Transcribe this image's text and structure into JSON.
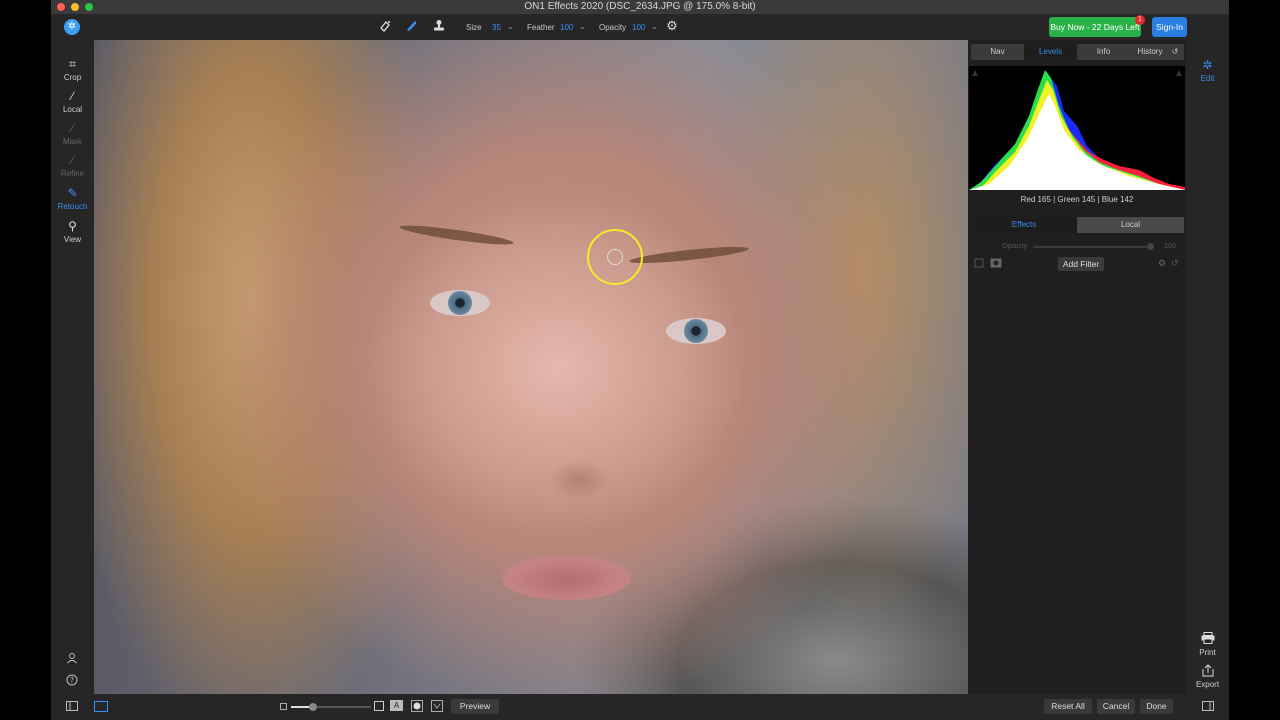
{
  "window": {
    "title": "ON1 Effects 2020 (DSC_2634.JPG @ 175.0% 8-bit)"
  },
  "toolbar": {
    "logo_glyph": "✲",
    "size_label": "Size",
    "size_value": "35",
    "feather_label": "Feather",
    "feather_value": "100",
    "opacity_label": "Opacity",
    "opacity_value": "100",
    "buy_label": "Buy Now - 22 Days Left",
    "buy_badge": "1",
    "signin_label": "Sign-In",
    "caret": "⌄"
  },
  "left_tools": [
    {
      "label": "Crop",
      "icon": "⌗",
      "state": "normal"
    },
    {
      "label": "Local",
      "icon": "⁄",
      "state": "normal"
    },
    {
      "label": "Mask",
      "icon": "⁄",
      "state": "dim"
    },
    {
      "label": "Refine",
      "icon": "⁄",
      "state": "dim"
    },
    {
      "label": "Retouch",
      "icon": "✎",
      "state": "active"
    },
    {
      "label": "View",
      "icon": "⚲",
      "state": "normal"
    }
  ],
  "panel": {
    "tabs": [
      "Nav",
      "Levels",
      "Info",
      "History"
    ],
    "selected_tab": "Levels",
    "history_icon": "↺",
    "rgb_readout": "Red 165 | Green 145 | Blue 142",
    "layer_tabs": [
      "Effects",
      "Local"
    ],
    "opacity_label": "Opacity",
    "opacity_value": "100",
    "add_filter_label": "Add Filter"
  },
  "right_rail": {
    "edit_label": "Edit",
    "print_label": "Print",
    "export_label": "Export"
  },
  "bottom": {
    "preview_label": "Preview",
    "reset_label": "Reset All",
    "cancel_label": "Cancel",
    "done_label": "Done",
    "compare_glyph": "A"
  },
  "colors": {
    "accent_blue": "#3a8ff0",
    "buy_green": "#2ab24a",
    "signin_blue": "#2a7de1",
    "brush_yellow": "#f5ea2a",
    "badge_red": "#e52929"
  }
}
